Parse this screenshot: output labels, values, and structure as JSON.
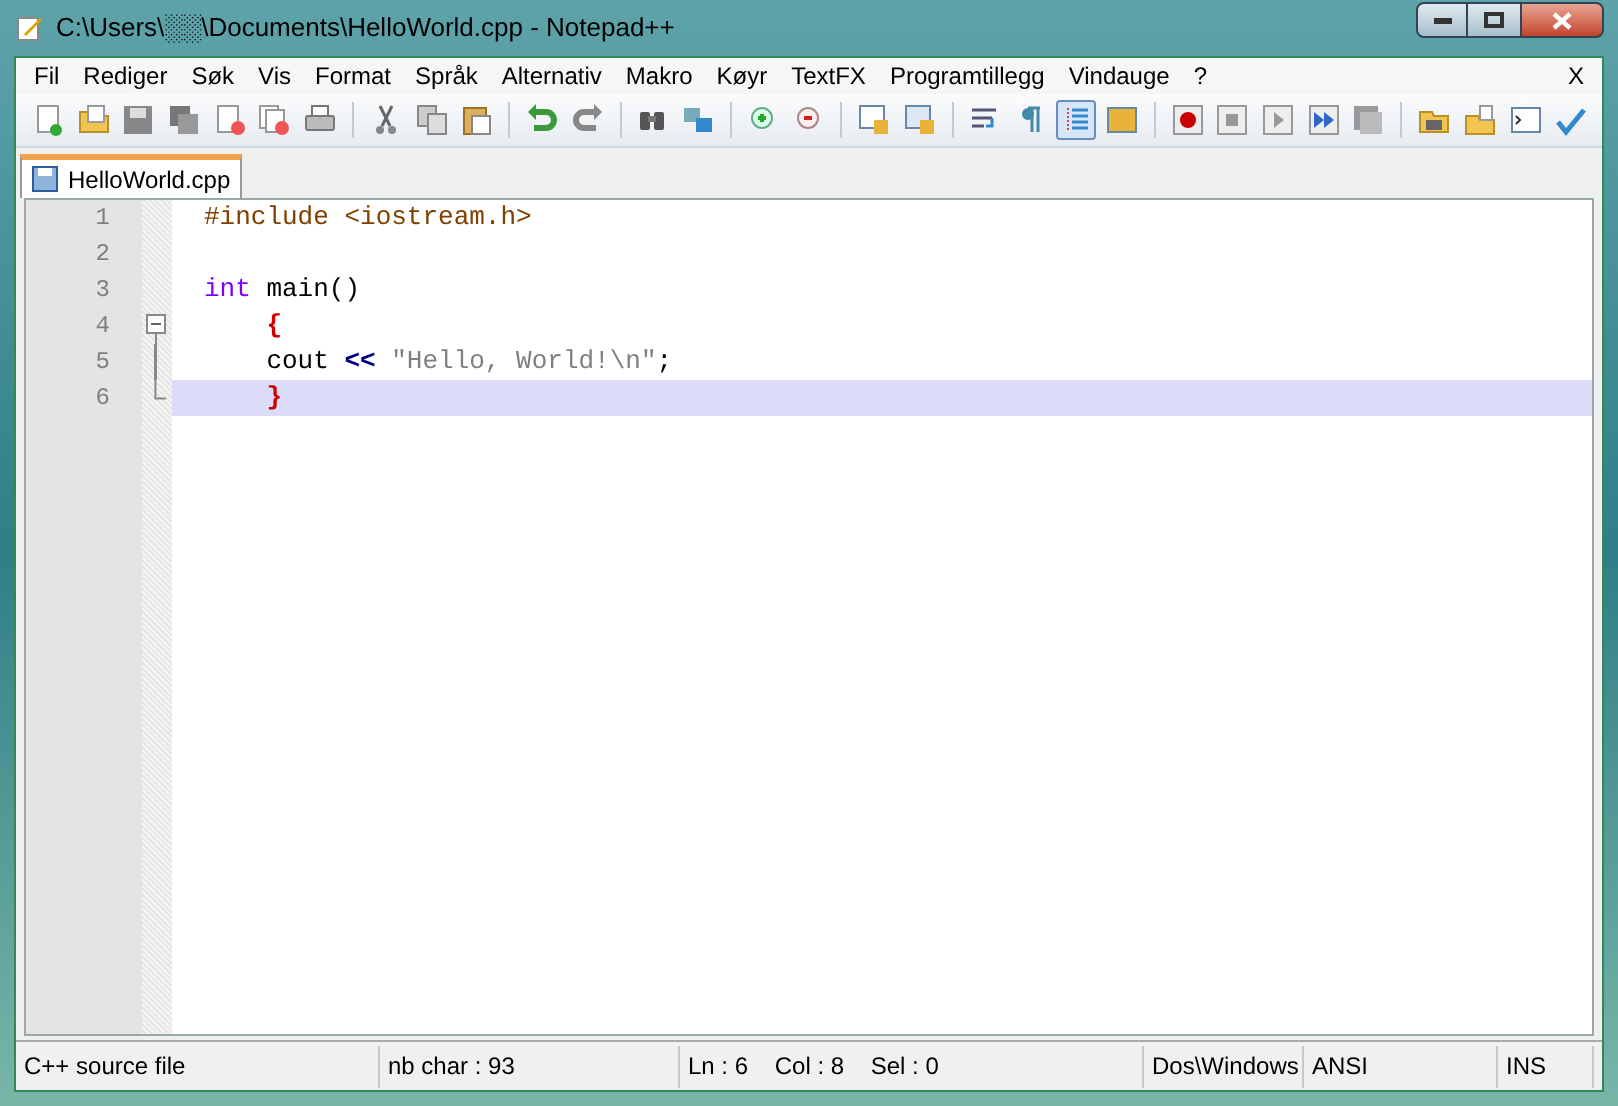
{
  "window": {
    "title": "C:\\Users\\░░\\Documents\\HelloWorld.cpp - Notepad++"
  },
  "menu": {
    "items": [
      "Fil",
      "Rediger",
      "Søk",
      "Vis",
      "Format",
      "Språk",
      "Alternativ",
      "Makro",
      "Køyr",
      "TextFX",
      "Programtillegg",
      "Vindauge",
      "?"
    ],
    "close": "X"
  },
  "toolbar": [
    {
      "kind": "new"
    },
    {
      "kind": "open"
    },
    {
      "kind": "save"
    },
    {
      "kind": "saveall"
    },
    {
      "kind": "close"
    },
    {
      "kind": "closeall"
    },
    {
      "kind": "print"
    },
    {
      "kind": "sep"
    },
    {
      "kind": "cut"
    },
    {
      "kind": "copy"
    },
    {
      "kind": "paste"
    },
    {
      "kind": "sep"
    },
    {
      "kind": "undo"
    },
    {
      "kind": "redo"
    },
    {
      "kind": "sep"
    },
    {
      "kind": "find"
    },
    {
      "kind": "replace"
    },
    {
      "kind": "sep"
    },
    {
      "kind": "zoomin"
    },
    {
      "kind": "zoomout"
    },
    {
      "kind": "sep"
    },
    {
      "kind": "syncv"
    },
    {
      "kind": "synch"
    },
    {
      "kind": "sep"
    },
    {
      "kind": "wrap"
    },
    {
      "kind": "pilcrow"
    },
    {
      "kind": "indent",
      "pressed": true
    },
    {
      "kind": "panel"
    },
    {
      "kind": "sep"
    },
    {
      "kind": "record"
    },
    {
      "kind": "stop"
    },
    {
      "kind": "play"
    },
    {
      "kind": "playmulti"
    },
    {
      "kind": "savemacro"
    },
    {
      "kind": "sep"
    },
    {
      "kind": "folder"
    },
    {
      "kind": "folder2"
    },
    {
      "kind": "console"
    },
    {
      "kind": "spell"
    }
  ],
  "tabs": [
    {
      "label": "HelloWorld.cpp",
      "selected": true
    }
  ],
  "editor": {
    "lines": [
      {
        "number": "1",
        "kind": "plain",
        "current": false,
        "tokens": [
          {
            "text": "#include <iostream.h>",
            "kind": "preproc"
          }
        ]
      },
      {
        "number": "2",
        "kind": "plain",
        "current": false
      },
      {
        "number": "3",
        "kind": "plain",
        "current": false,
        "tokens": [
          {
            "text": "int",
            "kind": "keyword"
          },
          {
            "text": " main()",
            "kind": "plain"
          }
        ]
      },
      {
        "number": "4",
        "kind": "fold_start",
        "current": false,
        "tokens": [
          {
            "text": "    {",
            "kind": "brace"
          }
        ]
      },
      {
        "number": "5",
        "kind": "fold_body",
        "current": false,
        "tokens": [
          {
            "text": "    cout ",
            "kind": "plain"
          },
          {
            "text": "<<",
            "kind": "operator"
          },
          {
            "text": " \"Hello, World!\\n\"",
            "kind": "string"
          },
          {
            "text": ";",
            "kind": "plain"
          }
        ]
      },
      {
        "number": "6",
        "kind": "fold_end",
        "current": true,
        "tokens": [
          {
            "text": "    }",
            "kind": "brace"
          }
        ]
      }
    ]
  },
  "status_bar": [
    "C++ source file",
    "nb char : 93",
    "Ln : 6    Col : 8    Sel : 0",
    "Dos\\Windows",
    "ANSI",
    "INS"
  ]
}
